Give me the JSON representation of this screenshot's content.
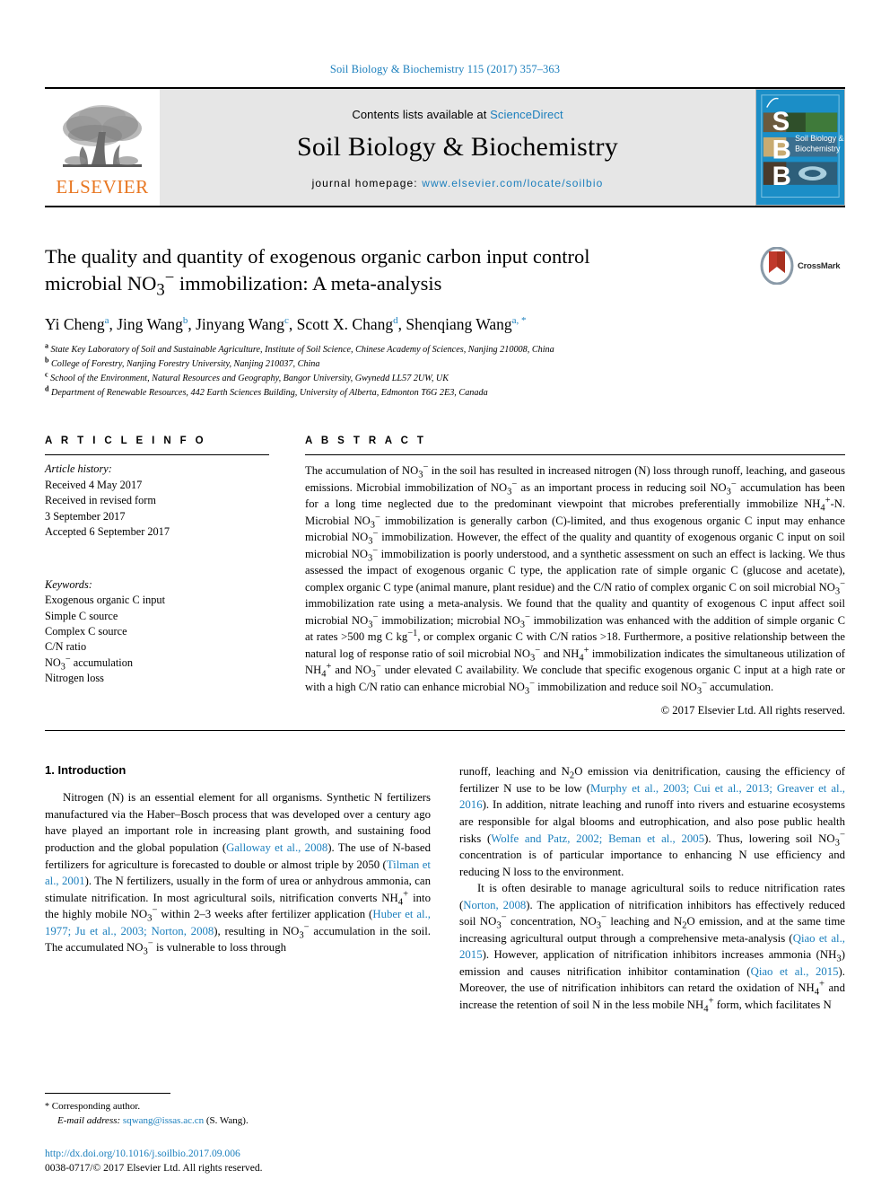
{
  "running_head": "Soil Biology & Biochemistry 115 (2017) 357–363",
  "masthead": {
    "publisher_name": "ELSEVIER",
    "contents_prefix": "Contents lists available at ",
    "contents_link": "ScienceDirect",
    "journal_name": "Soil Biology & Biochemistry",
    "homepage_prefix": "journal homepage: ",
    "homepage_url": "www.elsevier.com/locate/soilbio",
    "cover_title_line1": "Soil Biology &",
    "cover_title_line2": "Biochemistry",
    "cover_letters": [
      "S",
      "B",
      "B"
    ],
    "accent_link_color": "#1b7fbd",
    "elsevier_orange": "#e87722",
    "cover_blue": "#1b8ec7"
  },
  "article": {
    "title_line1": "The quality and quantity of exogenous organic carbon input control",
    "title_line2_pre": "microbial NO",
    "title_line2_sub": "3",
    "title_line2_sup": "−",
    "title_line2_post": " immobilization: A meta-analysis",
    "crossmark_label": "CrossMark",
    "authors": [
      {
        "name": "Yi Cheng",
        "mark": "a"
      },
      {
        "name": "Jing Wang",
        "mark": "b"
      },
      {
        "name": "Jinyang Wang",
        "mark": "c"
      },
      {
        "name": "Scott X. Chang",
        "mark": "d"
      },
      {
        "name": "Shenqiang Wang",
        "mark": "a, *"
      }
    ],
    "affiliations": [
      {
        "mark": "a",
        "text": "State Key Laboratory of Soil and Sustainable Agriculture, Institute of Soil Science, Chinese Academy of Sciences, Nanjing 210008, China"
      },
      {
        "mark": "b",
        "text": "College of Forestry, Nanjing Forestry University, Nanjing 210037, China"
      },
      {
        "mark": "c",
        "text": "School of the Environment, Natural Resources and Geography, Bangor University, Gwynedd LL57 2UW, UK"
      },
      {
        "mark": "d",
        "text": "Department of Renewable Resources, 442 Earth Sciences Building, University of Alberta, Edmonton T6G 2E3, Canada"
      }
    ]
  },
  "article_info": {
    "heading": "A R T I C L E  I N F O",
    "history_label": "Article history:",
    "history": [
      "Received 4 May 2017",
      "Received in revised form",
      "3 September 2017",
      "Accepted 6 September 2017"
    ],
    "keywords_label": "Keywords:",
    "keywords": [
      "Exogenous organic C input",
      "Simple C source",
      "Complex C source",
      "C/N ratio",
      "NO3 accumulation",
      "Nitrogen loss"
    ]
  },
  "abstract": {
    "heading": "A B S T R A C T",
    "copyright": "© 2017 Elsevier Ltd. All rights reserved."
  },
  "introduction": {
    "heading": "1.  Introduction"
  },
  "footnotes": {
    "corresponding_star": "*",
    "corresponding_label": "Corresponding author.",
    "email_label": "E-mail address:",
    "email": "sqwang@issas.ac.cn",
    "email_suffix": "(S. Wang).",
    "doi": "http://dx.doi.org/10.1016/j.soilbio.2017.09.006",
    "issn_line": "0038-0717/© 2017 Elsevier Ltd. All rights reserved."
  }
}
